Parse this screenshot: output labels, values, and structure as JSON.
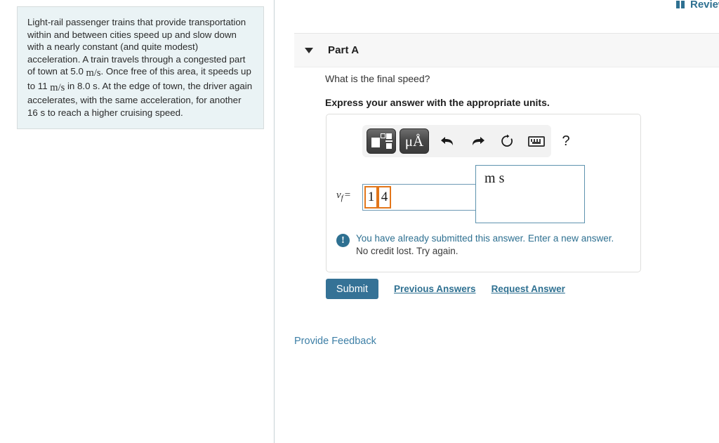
{
  "review": {
    "label": "Review",
    "icon": "bar-chart-icon",
    "color": "#2e7091"
  },
  "problem": {
    "segments": [
      {
        "type": "text",
        "value": "Light-rail passenger trains that provide transportation within and between cities speed up and slow down with a nearly constant (and quite modest) acceleration. A train travels through a congested part of town at 5.0 "
      },
      {
        "type": "math",
        "value": "m/s"
      },
      {
        "type": "text",
        "value": ". Once free of this area, it speeds up to 11 "
      },
      {
        "type": "math",
        "value": "m/s"
      },
      {
        "type": "text",
        "value": " in 8.0 s. At the edge of town, the driver again accelerates, with the same acceleration, for another 16 s to reach a higher cruising speed."
      }
    ],
    "full_text": "Light-rail passenger trains that provide transportation within and between cities speed up and slow down with a nearly constant (and quite modest) acceleration. A train travels through a congested part of town at 5.0 m/s . Once free of this area, it speeds up to 11 m/s in 8.0 s. At the edge of town, the driver again accelerates, with the same acceleration, for another 16 s to reach a higher cruising speed.",
    "part1": "Light-rail passenger trains that provide transportation within and between cities speed up and slow down with a nearly constant (and quite modest) acceleration. A train travels through a congested part of town at 5.0 ",
    "unit1_num": "m",
    "unit1_den": "s",
    "part2": ". Once free of this area, it speeds up to 11 ",
    "unit2_num": "m",
    "unit2_den": "s",
    "part3": " in 8.0 s. At the edge of town, the driver again accelerates, with the same acceleration, for another 16 s to reach a higher cruising speed.",
    "background": "#eaf3f5"
  },
  "part": {
    "title": "Part A",
    "expanded": true,
    "prompt": "What is the final speed?",
    "instruction": "Express your answer with the appropriate units."
  },
  "toolbar": {
    "template_button": {
      "name": "math-template-button",
      "label": ""
    },
    "units_button": {
      "name": "units-button",
      "label": "μÅ"
    },
    "undo": {
      "name": "undo-icon",
      "glyph": "⬅"
    },
    "redo": {
      "name": "redo-icon",
      "glyph": "➡"
    },
    "reset": {
      "name": "reset-icon",
      "glyph": "↻"
    },
    "keyboard": {
      "name": "keyboard-icon",
      "glyph": ""
    },
    "help": {
      "name": "help-icon",
      "glyph": "?"
    }
  },
  "answer": {
    "variable": "v",
    "variable_subscript": "f",
    "equals": "=",
    "digits": [
      "1",
      "4"
    ],
    "value": "14",
    "units_numerator": "m",
    "units_denominator": "s",
    "units_value": "m/s",
    "input_border_color": "#6e9ab5",
    "digit_highlight_color": "#e2761b"
  },
  "feedback": {
    "icon": "alert-exclamation-icon",
    "line1": "You have already submitted this answer. Enter a new answer.",
    "line2": "No credit lost. Try again.",
    "line1_color": "#2e7091"
  },
  "actions": {
    "submit_label": "Submit",
    "previous_answers_label": "Previous Answers",
    "request_answer_label": "Request Answer",
    "submit_color": "#357296"
  },
  "footer": {
    "provide_feedback_label": "Provide Feedback"
  }
}
